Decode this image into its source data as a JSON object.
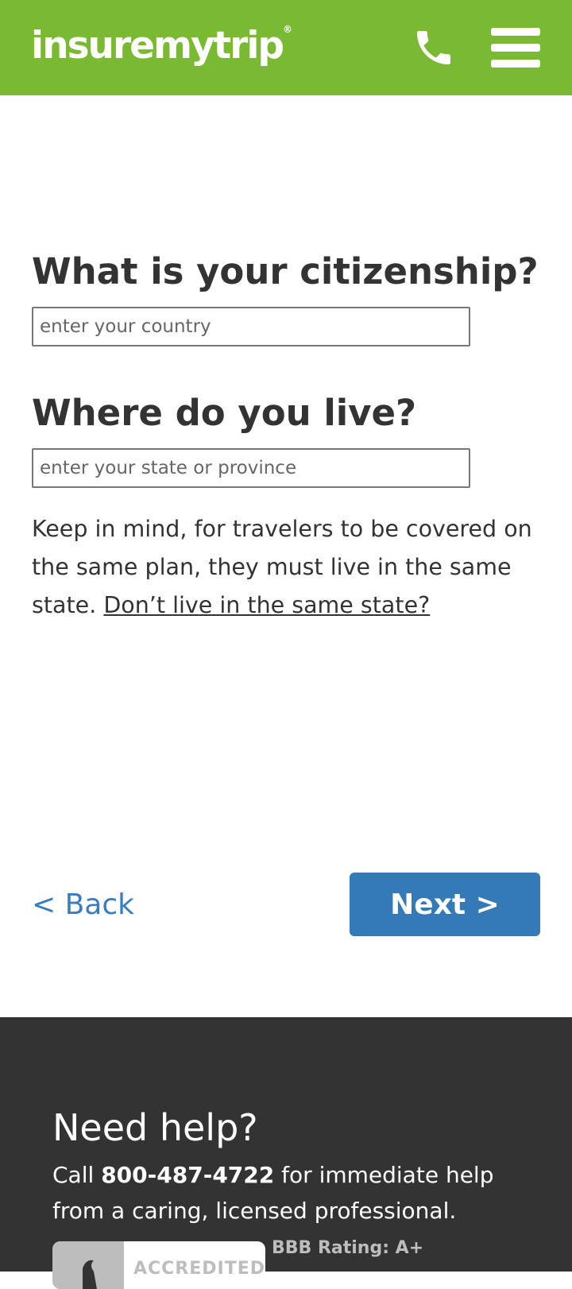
{
  "header": {
    "logo_text": "insuremytrip",
    "logo_registered": "®",
    "background_color": "#7ab932",
    "phone_icon": "phone-icon",
    "menu_icon": "hamburger-menu-icon"
  },
  "form": {
    "citizenship": {
      "heading": "What is your citizenship?",
      "placeholder": "enter your country",
      "value": ""
    },
    "residence": {
      "heading": "Where do you live?",
      "placeholder": "enter your state or province",
      "value": ""
    },
    "note": {
      "text": "Keep in mind, for travelers to be covered on the same plan, they must live in the same state.",
      "link_text": "Don’t live in the same state?"
    }
  },
  "navigation": {
    "back_label": "< Back",
    "next_label": "Next >",
    "accent_color": "#337ab7"
  },
  "footer": {
    "title": "Need help?",
    "call_prefix": "Call",
    "phone_number": "800-487-4722",
    "call_suffix": "for immediate help from a caring, licensed professional.",
    "bbb_badge_text": "ACCREDITED",
    "bbb_rating": "BBB Rating: A+",
    "background_color": "#333333"
  }
}
